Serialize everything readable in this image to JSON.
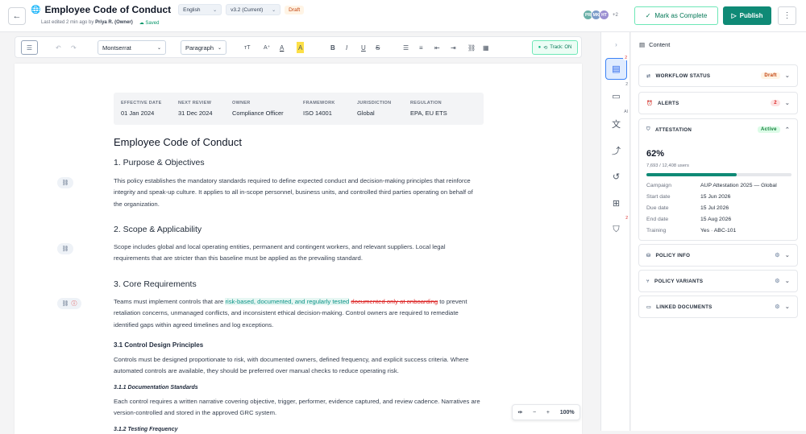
{
  "header": {
    "title": "Employee Code of Conduct",
    "language": "English",
    "version": "v3.2 (Current)",
    "status": "Draft",
    "last_edited": "Last edited 2 min ago by",
    "editor": "Priya R. (Owner)",
    "saved": "Saved",
    "avatars": [
      {
        "initials": "PR",
        "color": "#6ab0a8"
      },
      {
        "initials": "MK",
        "color": "#7c9cc9"
      },
      {
        "initials": "HT",
        "color": "#9b8fd1"
      }
    ],
    "avatars_more": "+2",
    "mark_complete": "Mark as Complete",
    "publish": "Publish"
  },
  "toolbar": {
    "font": "Montserrat",
    "style": "Paragraph",
    "track": "Track: ON"
  },
  "document": {
    "meta": [
      {
        "label": "EFFECTIVE DATE",
        "value": "01 Jan 2024"
      },
      {
        "label": "NEXT REVIEW",
        "value": "31 Dec 2024"
      },
      {
        "label": "OWNER",
        "value": "Compliance Officer"
      },
      {
        "label": "FRAMEWORK",
        "value": "ISO 14001"
      },
      {
        "label": "JURISDICTION",
        "value": "Global"
      },
      {
        "label": "REGULATION",
        "value": "EPA, EU ETS"
      }
    ],
    "title": "Employee Code of Conduct",
    "s1_heading": "1. Purpose & Objectives",
    "s1_text": "This policy establishes the mandatory standards required to define expected conduct and decision-making principles that reinforce integrity and speak-up culture. It applies to all in-scope personnel, business units, and controlled third parties operating on behalf of the organization.",
    "s2_heading": "2. Scope & Applicability",
    "s2_text": "Scope includes global and local operating entities, permanent and contingent workers, and relevant suppliers. Local legal requirements that are stricter than this baseline must be applied as the prevailing standard.",
    "s3_heading": "3. Core Requirements",
    "s3_pre": "Teams must implement controls that are ",
    "s3_ins": "risk-based, documented, and regularly tested",
    "s3_del": "documented only at onboarding",
    "s3_post": " to prevent retaliation concerns, unmanaged conflicts, and inconsistent ethical decision-making. Control owners are required to remediate identified gaps within agreed timelines and log exceptions.",
    "s31_heading": "3.1 Control Design Principles",
    "s31_text": "Controls must be designed proportionate to risk, with documented owners, defined frequency, and explicit success criteria. Where automated controls are available, they should be preferred over manual checks to reduce operating risk.",
    "s311_heading": "3.1.1 Documentation Standards",
    "s311_text": "Each control requires a written narrative covering objective, trigger, performer, evidence captured, and review cadence. Narratives are version-controlled and stored in the approved GRC system.",
    "s312_heading": "3.1.2 Testing Frequency"
  },
  "zoom": "100%",
  "rail": {
    "content_badge": "2",
    "comments_badge": "2",
    "ai_badge": "AI",
    "shield_badge": "2"
  },
  "panel": {
    "title": "Content",
    "workflow": {
      "label": "WORKFLOW STATUS",
      "badge": "Draft"
    },
    "alerts": {
      "label": "ALERTS",
      "badge": "2"
    },
    "attestation": {
      "label": "ATTESTATION",
      "badge": "Active",
      "pct": "62%",
      "progress": 0.62,
      "users": "7,693 / 12,408 users",
      "rows": [
        {
          "k": "Campaign",
          "v": "AUP Attestation 2025 — Global"
        },
        {
          "k": "Start date",
          "v": "15 Jun 2026"
        },
        {
          "k": "Due date",
          "v": "15 Jul 2026"
        },
        {
          "k": "End date",
          "v": "15 Aug 2026"
        },
        {
          "k": "Training",
          "v": "Yes · ABC-101"
        }
      ]
    },
    "policy_info": "POLICY INFO",
    "policy_variants": "POLICY VARIANTS",
    "linked_documents": "LINKED DOCUMENTS"
  }
}
